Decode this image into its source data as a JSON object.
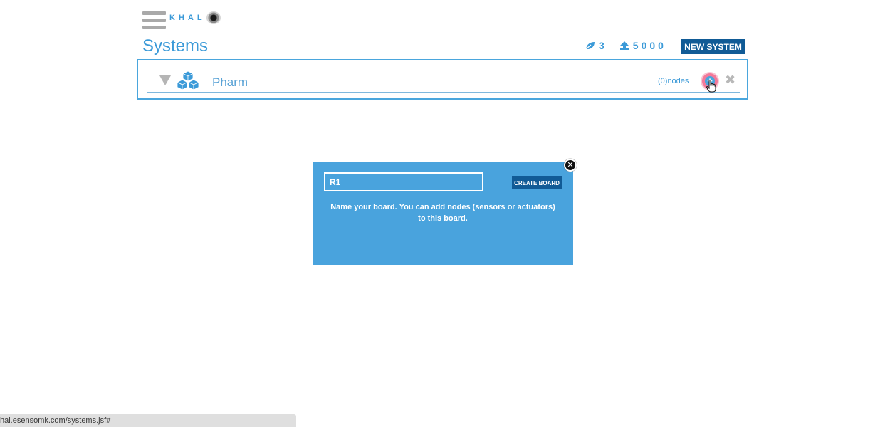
{
  "header": {
    "logo_text": "KHAL",
    "page_title": "Systems",
    "stats": {
      "systems_count": "3",
      "credits": "5000"
    },
    "new_system_label": "NEW SYSTEM"
  },
  "system": {
    "name": "Pharm",
    "nodes_label": "(0)nodes",
    "add_label": "+",
    "delete_label": "✖"
  },
  "modal": {
    "input_value": "R1",
    "create_button_label": "CREATE BOARD",
    "hint": "Name your board. You can add nodes (sensors or actuators) to this board.",
    "close_label": "✕"
  },
  "status_bar": {
    "url": "hal.esensomk.com/systems.jsf#"
  },
  "colors": {
    "accent": "#3b9ad8",
    "dark_button": "#115b96",
    "modal_bg": "#49a3dd"
  }
}
